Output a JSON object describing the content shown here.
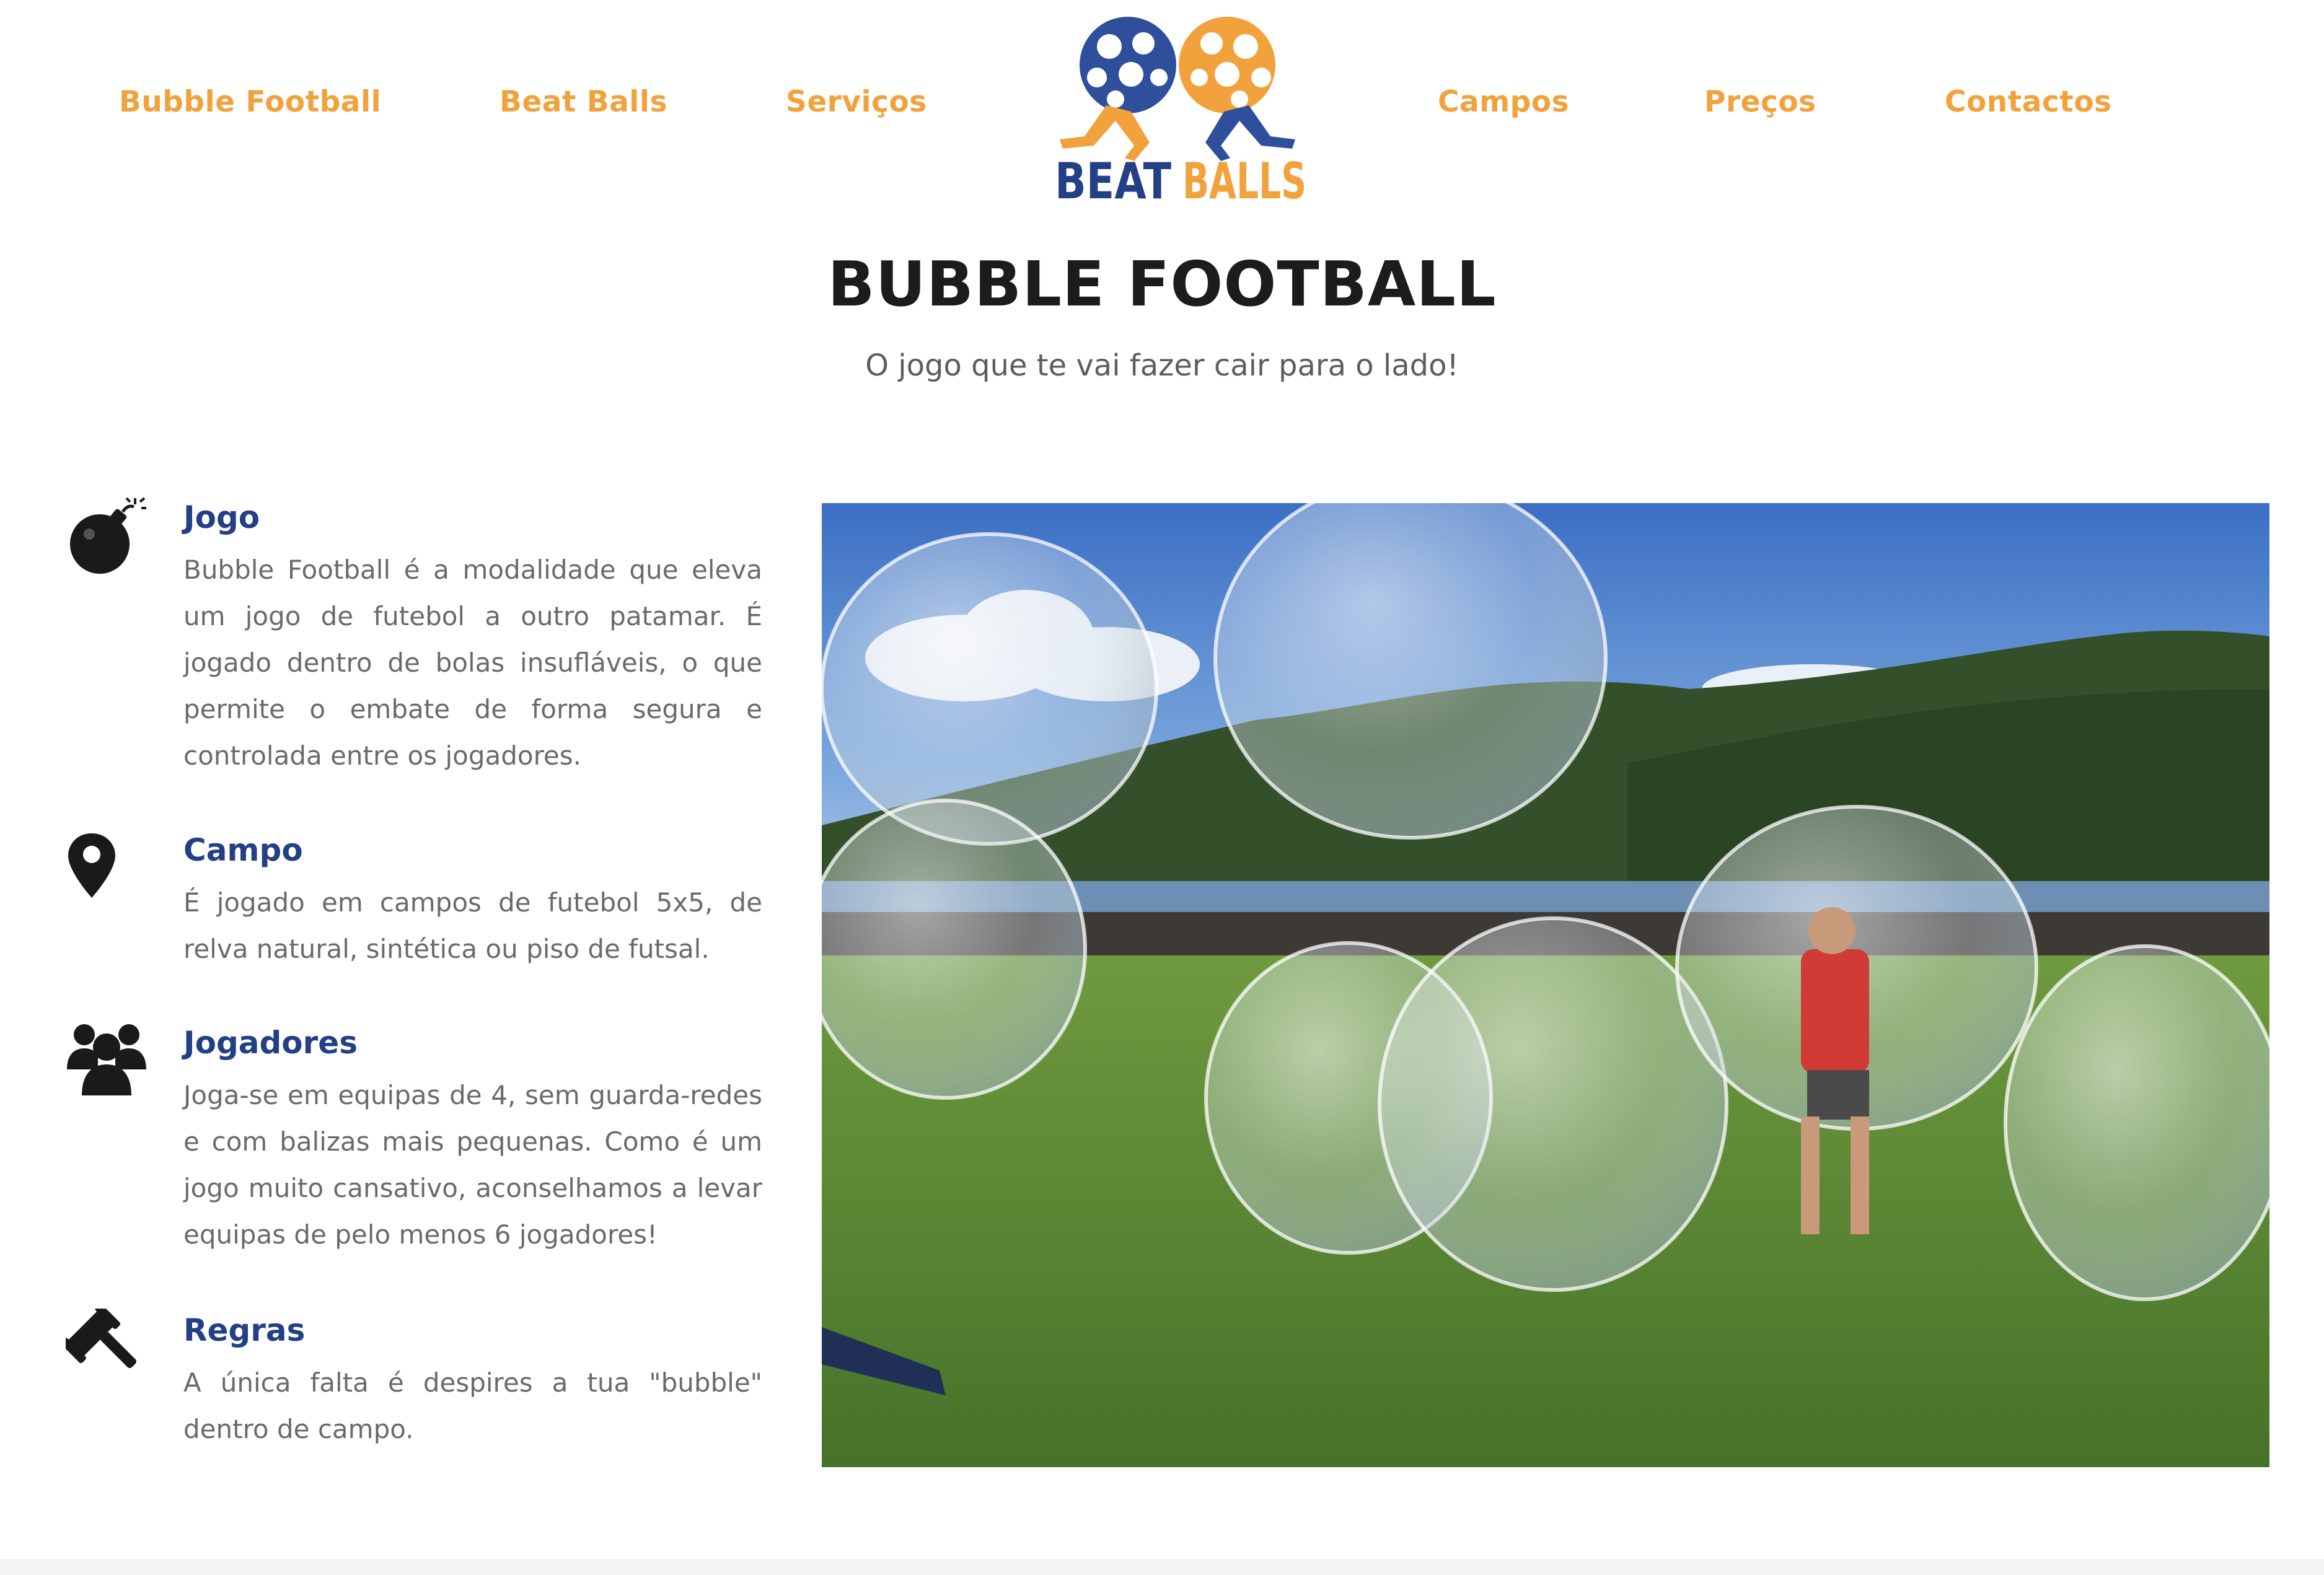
{
  "nav": {
    "items": [
      {
        "label": "Bubble Football"
      },
      {
        "label": "Beat Balls"
      },
      {
        "label": "Serviços"
      },
      {
        "label": "Campos"
      },
      {
        "label": "Preços"
      },
      {
        "label": "Contactos"
      }
    ]
  },
  "logo": {
    "word1": "BEAT",
    "word2": "BALLS",
    "primary_color": "#233f86",
    "accent_color": "#f2a23c"
  },
  "hero": {
    "title": "BUBBLE FOOTBALL",
    "subtitle": "O jogo que te vai fazer cair para o lado!"
  },
  "features": [
    {
      "icon": "bomb-icon",
      "title": "Jogo",
      "text": "Bubble Football é a modalidade que eleva um jogo de futebol a outro patamar. É jogado dentro de bolas insufláveis, o que permite o embate de forma segura e controlada entre os jogadores."
    },
    {
      "icon": "map-marker-icon",
      "title": "Campo",
      "text": "É jogado em campos de futebol 5x5, de relva natural, sintética ou piso de futsal."
    },
    {
      "icon": "users-icon",
      "title": "Jogadores",
      "text": "Joga-se em equipas de 4, sem guarda-redes e com balizas mais pequenas. Como é um jogo muito cansativo, aconselhamos a levar equipas de pelo menos 6 jogadores!"
    },
    {
      "icon": "gavel-icon",
      "title": "Regras",
      "text": "A única falta é despires a tua \"bubble\" dentro de campo."
    }
  ],
  "colors": {
    "nav_link": "#f2a23c",
    "feature_title": "#233f86",
    "body_text": "#6a6a6a",
    "heading": "#1c1c1c"
  }
}
